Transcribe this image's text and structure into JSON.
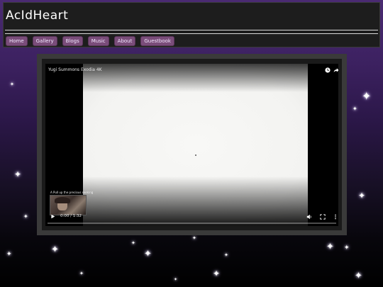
{
  "site": {
    "title": "AcIdHeart"
  },
  "nav": {
    "items": [
      {
        "label": "Home"
      },
      {
        "label": "Gallery"
      },
      {
        "label": "Blogs"
      },
      {
        "label": "Music"
      },
      {
        "label": "About"
      },
      {
        "label": "Guestbook"
      }
    ]
  },
  "video": {
    "title": "Yugi Summons Exodia 4K",
    "thumbnail_caption": "A Pull up the precious seeking",
    "time": "0:00 / 1:32",
    "progress": 0,
    "icons": {
      "watch_later": "clock-icon",
      "share": "share-icon",
      "play": "play-icon",
      "volume": "volume-icon",
      "fullscreen": "fullscreen-icon",
      "more": "more-vertical-icon"
    }
  },
  "colors": {
    "nav_button": "#7a4d7a",
    "header_bg": "#1d1d1d",
    "player_frame": "#3a3a3a"
  }
}
